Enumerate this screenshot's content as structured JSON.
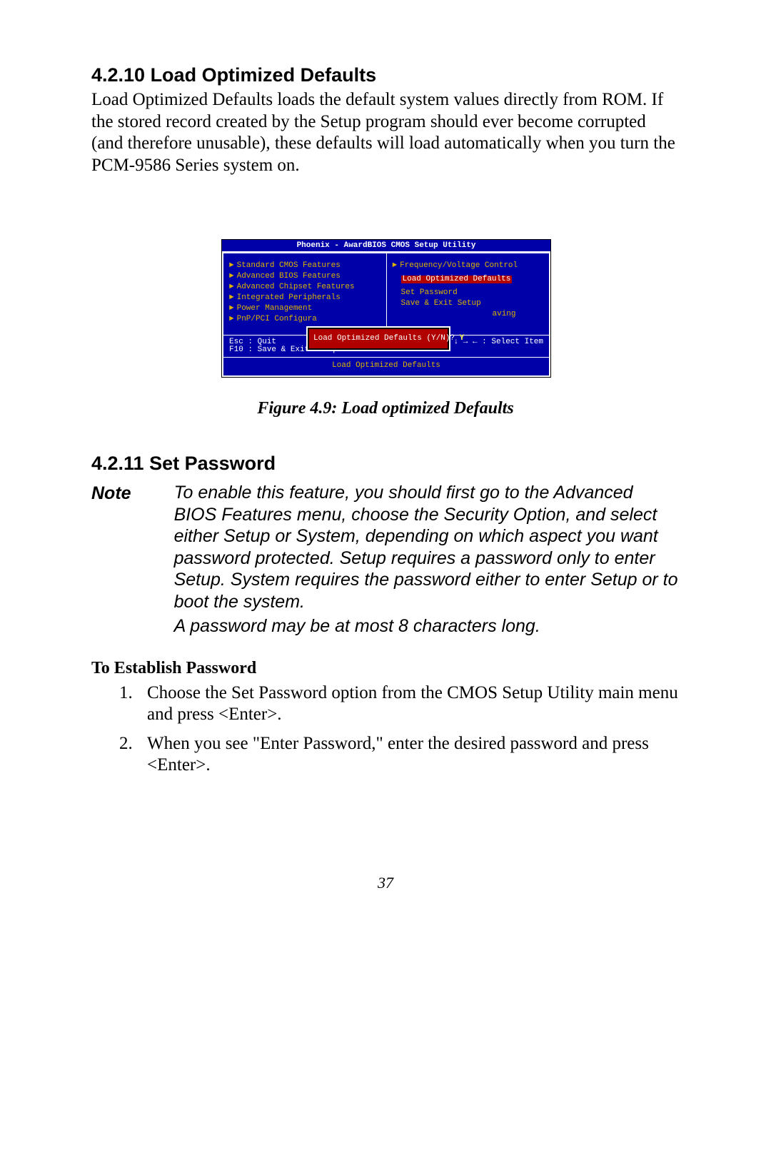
{
  "section1": {
    "heading": "4.2.10 Load Optimized Defaults",
    "para": "Load Optimized Defaults loads the default system values directly from ROM. If the stored record created by the Setup program should ever become corrupted (and therefore unusable), these defaults will load automatically when you turn the PCM-9586 Series system on."
  },
  "bios": {
    "title": "Phoenix - AwardBIOS CMOS Setup Utility",
    "left": [
      "Standard CMOS Features",
      "Advanced BIOS Features",
      "Advanced Chipset Features",
      "Integrated Peripherals",
      "Power Management",
      "PnP/PCI Configura"
    ],
    "right_arrow": "Frequency/Voltage Control",
    "right_selected": "Load Optimized Defaults",
    "right_items": [
      "Set Password",
      "Save & Exit Setup"
    ],
    "right_tail": "aving",
    "popup": "Load Optimized Defaults (Y/N)?",
    "popup_answer": "Y",
    "legend_left1": "Esc : Quit",
    "legend_left2": "F10 : Save & Exit Setup",
    "legend_right": "↑ ↓ → ←   : Select Item",
    "footer": "Load Optimized Defaults"
  },
  "figcaption": "Figure 4.9: Load optimized Defaults",
  "section2": {
    "heading": "4.2.11 Set Password",
    "note_label": "Note",
    "note_p1": "To enable this feature, you should first go to the Advanced BIOS Features menu, choose the Security Option, and select either Setup or System, depending on which aspect you want password protected. Setup requires a password only to enter Setup.  System requires the password either to enter Setup or to boot the system.",
    "note_p2": "A password may be at most 8 characters long.",
    "subhead": "To Establish Password",
    "step1": "Choose the Set Password option from the CMOS Setup Utility main menu and press <Enter>.",
    "step2": "When you see \"Enter Password,\" enter the desired password and press <Enter>."
  },
  "page_number": "37"
}
